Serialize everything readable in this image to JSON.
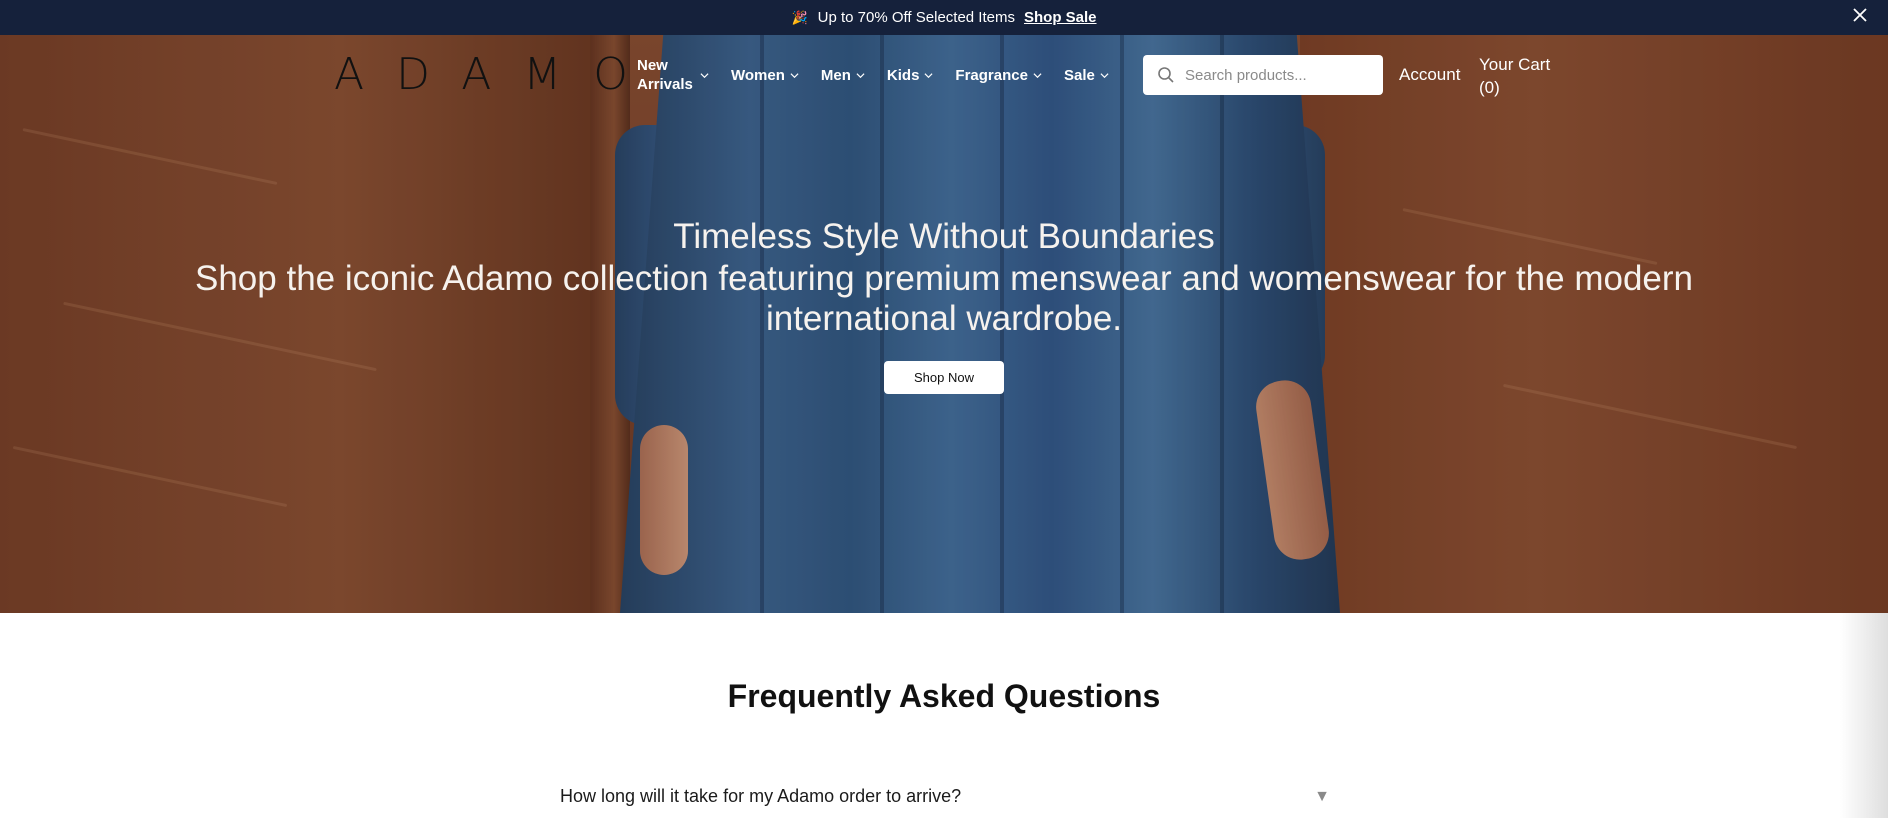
{
  "announcement": {
    "icon": "party-cone-icon",
    "text": "Up to 70% Off Selected Items",
    "link": "Shop Sale"
  },
  "brand": {
    "logo": "ADAMO"
  },
  "nav": {
    "items": [
      {
        "label": "New Arrivals"
      },
      {
        "label": "Women"
      },
      {
        "label": "Men"
      },
      {
        "label": "Kids"
      },
      {
        "label": "Fragrance"
      },
      {
        "label": "Sale"
      }
    ]
  },
  "search": {
    "placeholder": "Search products...",
    "value": ""
  },
  "account": {
    "label": "Account"
  },
  "cart": {
    "label": "Your Cart (0)"
  },
  "hero": {
    "title": "Timeless Style Without Boundaries",
    "subtitle": "Shop the iconic Adamo collection featuring premium menswear and womenswear for the modern international wardrobe.",
    "cta": "Shop Now"
  },
  "faq": {
    "title": "Frequently Asked Questions",
    "items": [
      {
        "question": "How long will it take for my Adamo order to arrive?",
        "arrow": "▼"
      }
    ]
  },
  "colors": {
    "announce_bg": "#15213b",
    "text_white": "#ffffff",
    "text_dark": "#111111"
  }
}
